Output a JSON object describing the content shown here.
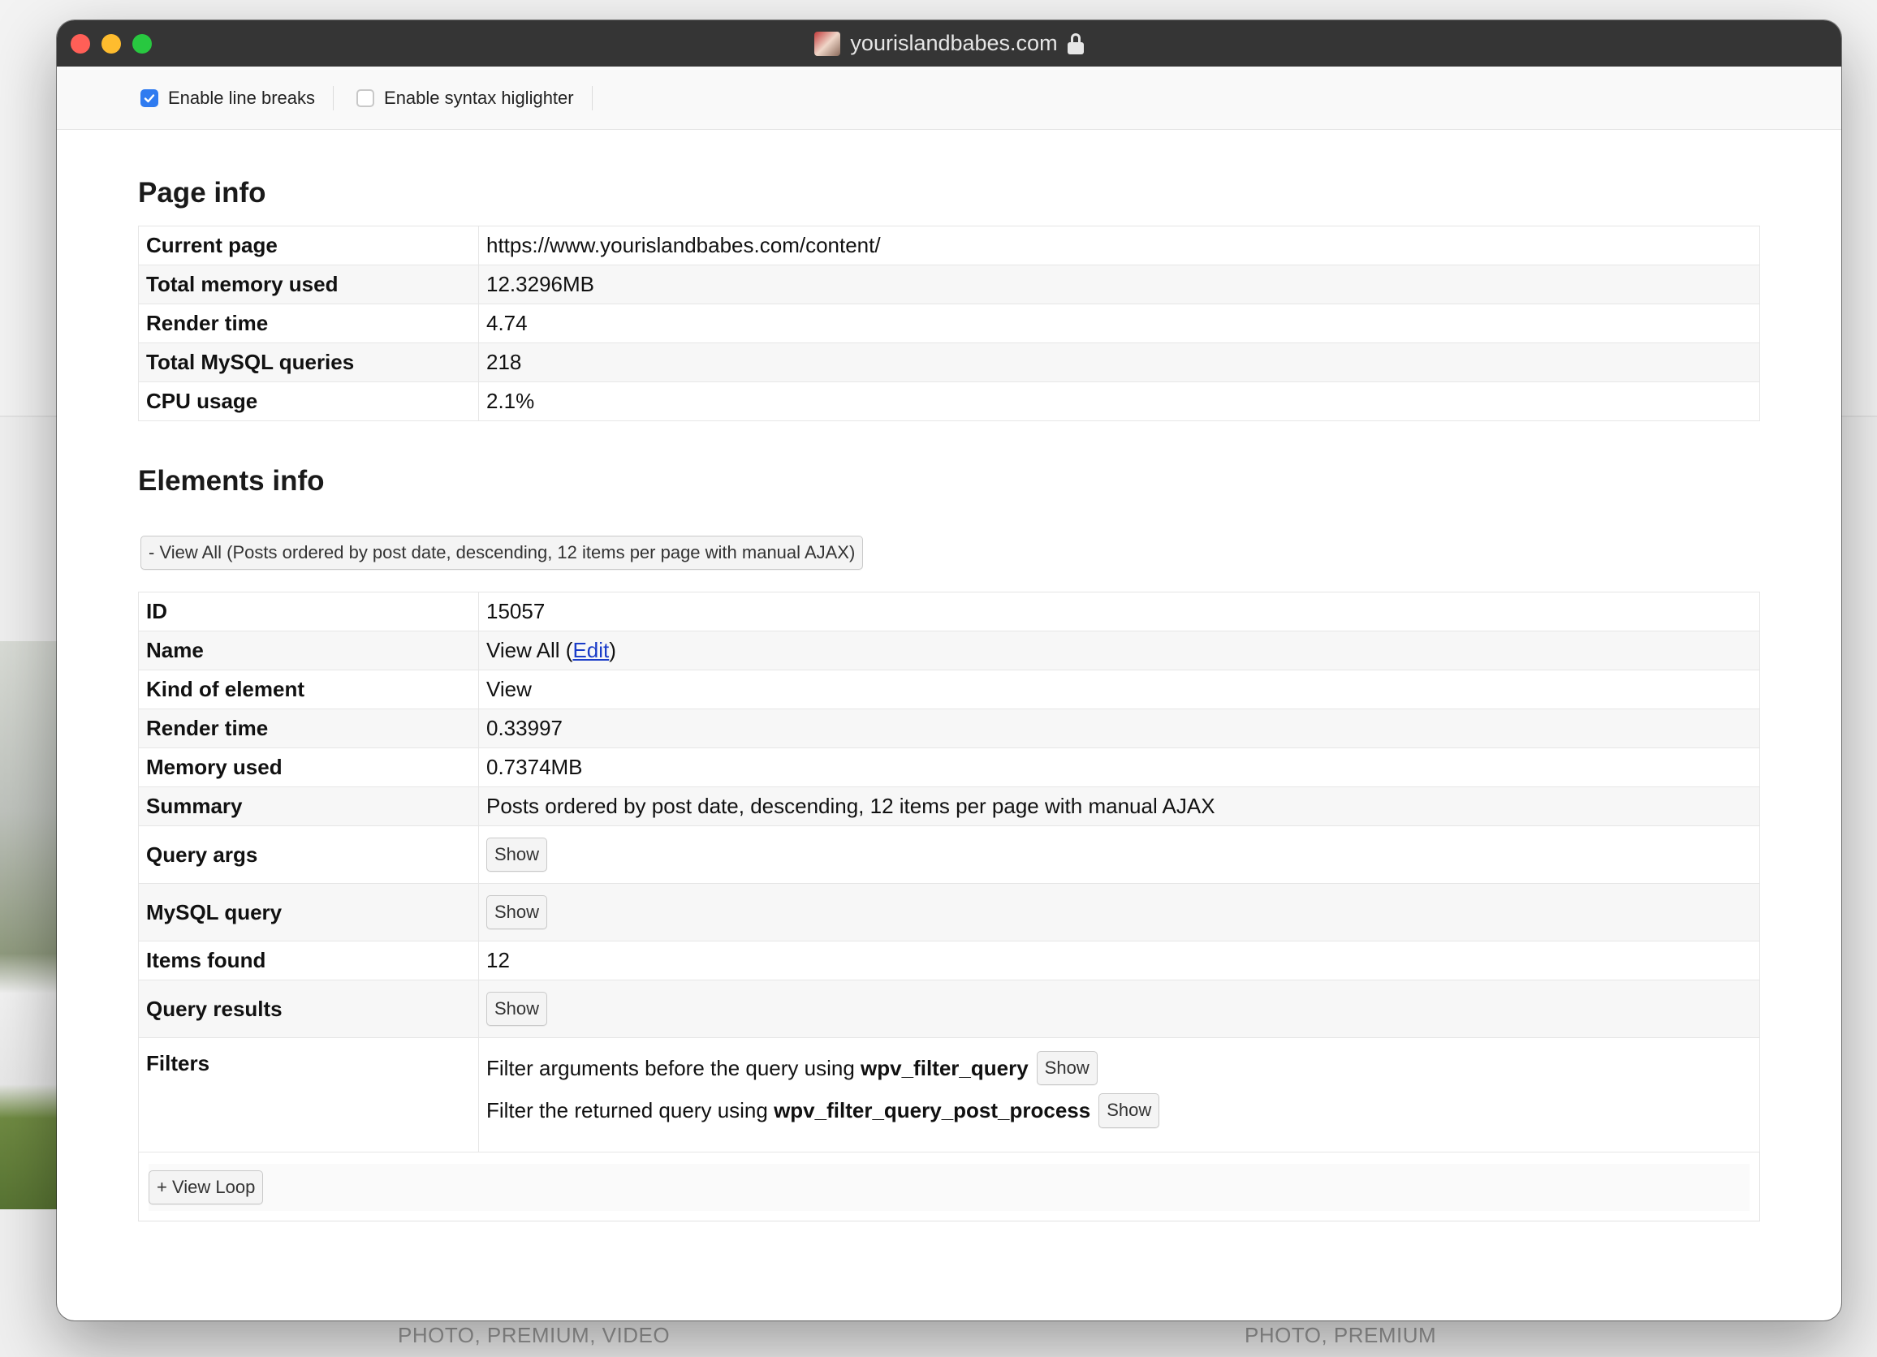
{
  "window": {
    "title": "yourislandbabes.com"
  },
  "toolbar": {
    "line_breaks": {
      "label": "Enable line breaks",
      "checked": true
    },
    "syntax": {
      "label": "Enable syntax higlighter",
      "checked": false
    }
  },
  "page_info": {
    "heading": "Page info",
    "rows": [
      {
        "key": "Current page",
        "value": "https://www.yourislandbabes.com/content/"
      },
      {
        "key": "Total memory used",
        "value": "12.3296MB"
      },
      {
        "key": "Render time",
        "value": "4.74"
      },
      {
        "key": "Total MySQL queries",
        "value": "218"
      },
      {
        "key": "CPU usage",
        "value": "2.1%"
      }
    ]
  },
  "elements_info": {
    "heading": "Elements info",
    "toggle_label": "- View All (Posts ordered by post date, descending, 12 items per page with manual AJAX)",
    "id": {
      "key": "ID",
      "value": "15057"
    },
    "name": {
      "key": "Name",
      "value": "View All (",
      "link": "Edit",
      "suffix": ")"
    },
    "kind": {
      "key": "Kind of element",
      "value": "View"
    },
    "render": {
      "key": "Render time",
      "value": "0.33997"
    },
    "memory": {
      "key": "Memory used",
      "value": "0.7374MB"
    },
    "summary": {
      "key": "Summary",
      "value": "Posts ordered by post date, descending, 12 items per page with manual AJAX"
    },
    "query_args": {
      "key": "Query args",
      "button": "Show"
    },
    "mysql_query": {
      "key": "MySQL query",
      "button": "Show"
    },
    "items_found": {
      "key": "Items found",
      "value": "12"
    },
    "query_results": {
      "key": "Query results",
      "button": "Show"
    },
    "filters": {
      "key": "Filters",
      "f1_text": "Filter arguments before the query using ",
      "f1_hook": "wpv_filter_query",
      "f1_button": "Show",
      "f2_text": "Filter the returned query using ",
      "f2_hook": "wpv_filter_query_post_process",
      "f2_button": "Show"
    },
    "view_loop_label": "+ View Loop"
  },
  "background": {
    "caption_left": "PHOTO, PREMIUM, VIDEO",
    "caption_right": "PHOTO, PREMIUM"
  },
  "colors": {
    "checkbox_accent": "#2f7bf0",
    "link": "#1a3cc8",
    "titlebar": "#353535"
  }
}
